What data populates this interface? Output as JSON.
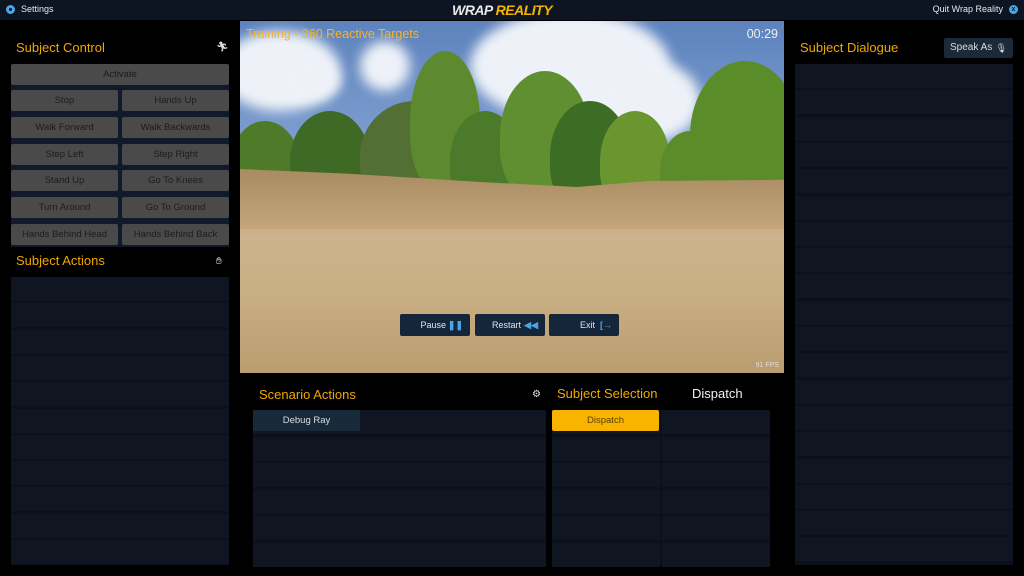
{
  "topbar": {
    "settings_label": "Settings",
    "logo_left": "WRAP",
    "logo_right": "REALITY",
    "quit_label": "Quit Wrap Reality",
    "quit_icon": "x"
  },
  "subject_control": {
    "title": "Subject Control",
    "icon": "running-person",
    "activate_label": "Activate",
    "buttons": [
      [
        "Stop",
        "Hands Up"
      ],
      [
        "Walk Forward",
        "Walk Backwards"
      ],
      [
        "Step Left",
        "Step Right"
      ],
      [
        "Stand Up",
        "Go To Knees"
      ],
      [
        "Turn Around",
        "Go To Ground"
      ],
      [
        "Hands Behind Head",
        "Hands Behind Back"
      ]
    ]
  },
  "subject_actions": {
    "title": "Subject Actions",
    "icon": "hand"
  },
  "viewport": {
    "scenario_title": "Training - 360 Reactive Targets",
    "timer": "00:29",
    "fps": "91 FPS",
    "controls": [
      {
        "label": "Pause",
        "icon": "❚❚"
      },
      {
        "label": "Restart",
        "icon": "◀◀"
      },
      {
        "label": "Exit",
        "icon": "[→"
      }
    ]
  },
  "scenario_actions": {
    "title": "Scenario Actions",
    "icon": "gear",
    "items": [
      "Debug Ray"
    ]
  },
  "subject_selection": {
    "title": "Subject Selection",
    "tab_dispatch": "Dispatch",
    "items": [
      "Dispatch"
    ],
    "accent": "#f9b400"
  },
  "subject_dialogue": {
    "title": "Subject Dialogue",
    "speak_as_label": "Speak As",
    "speak_icon": "microphone"
  }
}
